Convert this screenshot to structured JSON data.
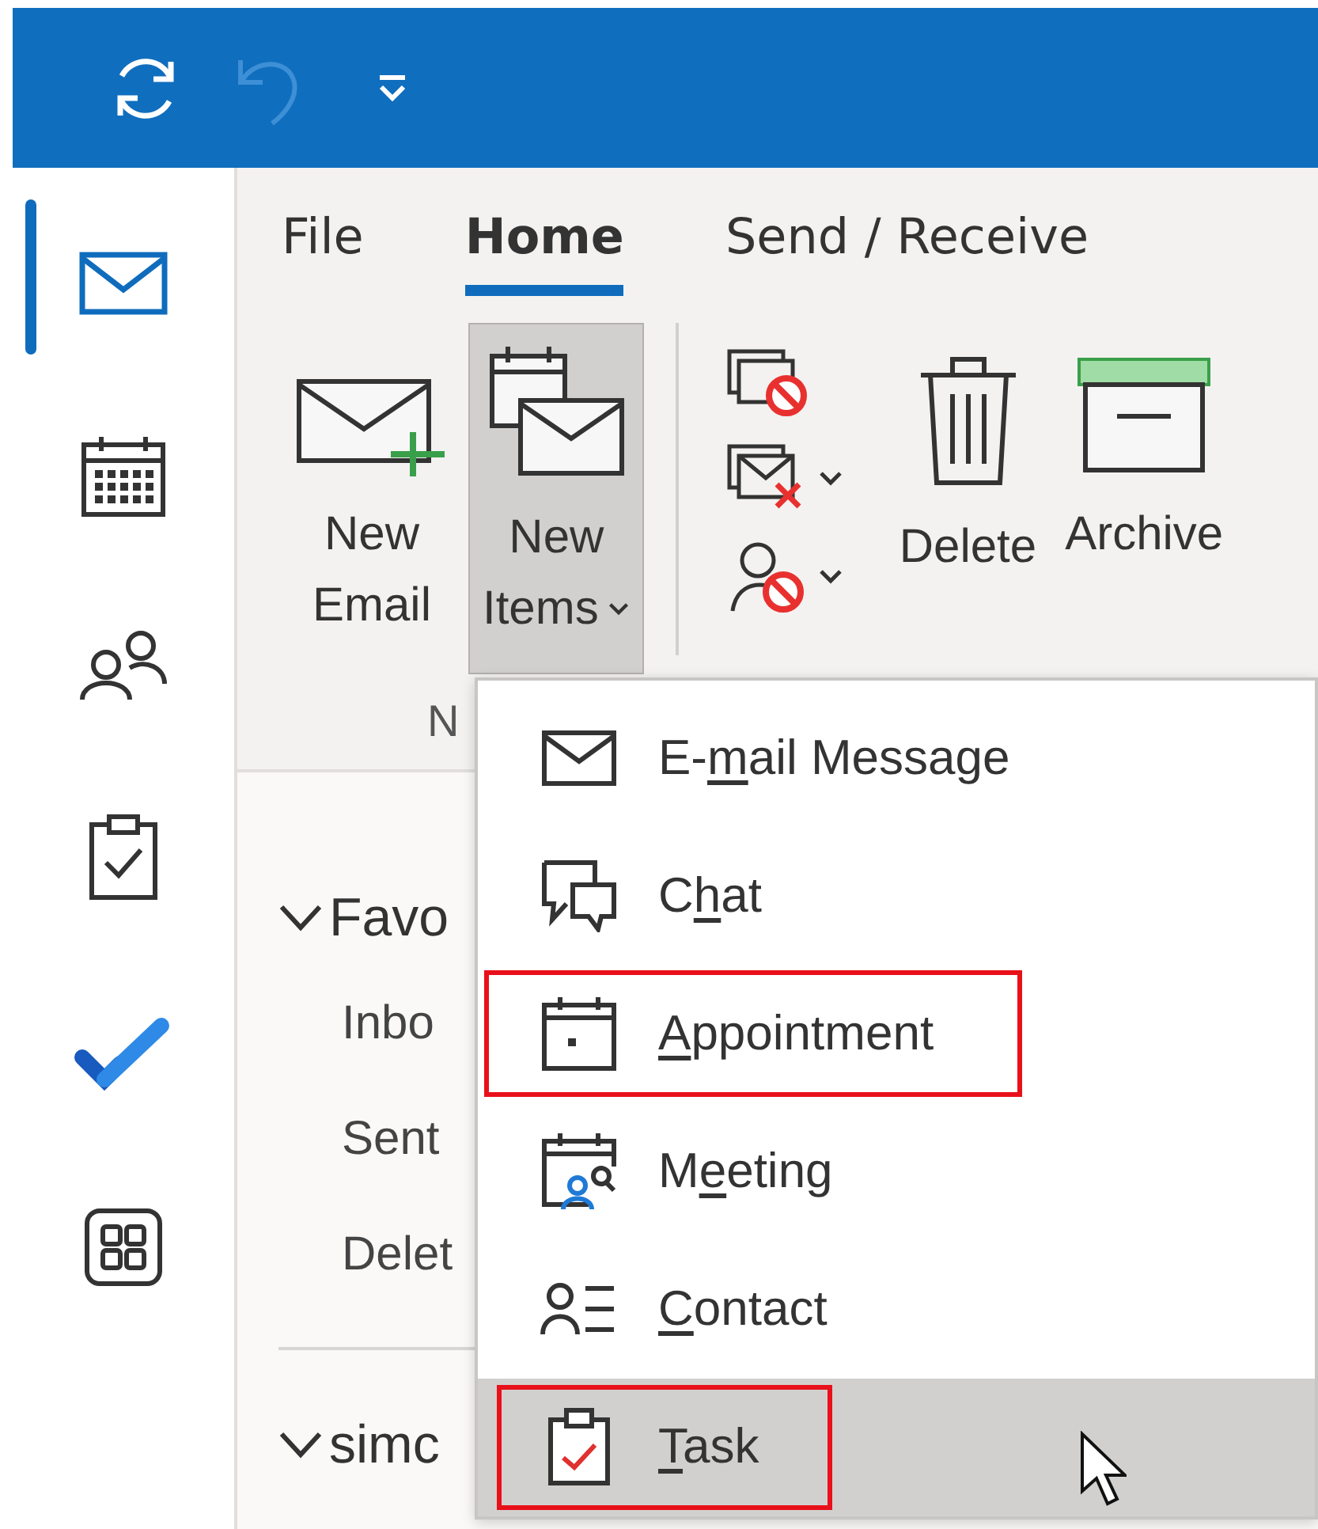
{
  "rail": [
    {
      "kind": "mail",
      "selected": true
    },
    {
      "kind": "calendar",
      "selected": false
    },
    {
      "kind": "people",
      "selected": false
    },
    {
      "kind": "tasks",
      "selected": false
    },
    {
      "kind": "todo",
      "selected": false
    },
    {
      "kind": "apps",
      "selected": false
    }
  ],
  "tabs": [
    {
      "label": "File",
      "selected": false
    },
    {
      "label": "Home",
      "selected": true
    },
    {
      "label": "Send / Receive",
      "selected": false
    }
  ],
  "ribbon": {
    "buttons": [
      {
        "kind": "new-email",
        "lines": [
          "New",
          "Email"
        ],
        "selected": false,
        "dropdown": false
      },
      {
        "kind": "new-items",
        "lines": [
          "New",
          "Items"
        ],
        "selected": true,
        "dropdown": true
      },
      {
        "kind": "delete",
        "lines": [
          "Delete"
        ],
        "selected": false,
        "dropdown": false
      },
      {
        "kind": "archive",
        "lines": [
          "Archive"
        ],
        "selected": false,
        "dropdown": false
      }
    ],
    "group_label": "N"
  },
  "folders": [
    {
      "kind": "header",
      "label": "Favo"
    },
    {
      "kind": "folder",
      "label": "Inbo"
    },
    {
      "kind": "folder",
      "label": "Sent"
    },
    {
      "kind": "folder",
      "label": "Delet"
    },
    {
      "kind": "divider"
    },
    {
      "kind": "header",
      "label": "simc"
    }
  ],
  "menu": [
    {
      "kind": "mail",
      "parts": [
        {
          "text": "E-",
          "key": false
        },
        {
          "text": "m",
          "key": true
        },
        {
          "text": "ail Message",
          "key": false
        }
      ],
      "selected": false,
      "highlighted": false
    },
    {
      "kind": "chat",
      "parts": [
        {
          "text": "C",
          "key": false
        },
        {
          "text": "h",
          "key": true
        },
        {
          "text": "at",
          "key": false
        }
      ],
      "selected": false,
      "highlighted": false
    },
    {
      "kind": "appointment",
      "parts": [
        {
          "text": "A",
          "key": true
        },
        {
          "text": "ppointment",
          "key": false
        }
      ],
      "selected": false,
      "highlighted": true
    },
    {
      "kind": "meeting",
      "parts": [
        {
          "text": "M",
          "key": false
        },
        {
          "text": "e",
          "key": true
        },
        {
          "text": "eting",
          "key": false
        }
      ],
      "selected": false,
      "highlighted": false
    },
    {
      "kind": "contact",
      "parts": [
        {
          "text": "C",
          "key": true
        },
        {
          "text": "ontact",
          "key": false
        }
      ],
      "selected": false,
      "highlighted": false
    },
    {
      "kind": "task",
      "parts": [
        {
          "text": "T",
          "key": true
        },
        {
          "text": "ask",
          "key": false
        }
      ],
      "selected": true,
      "highlighted": true
    }
  ]
}
